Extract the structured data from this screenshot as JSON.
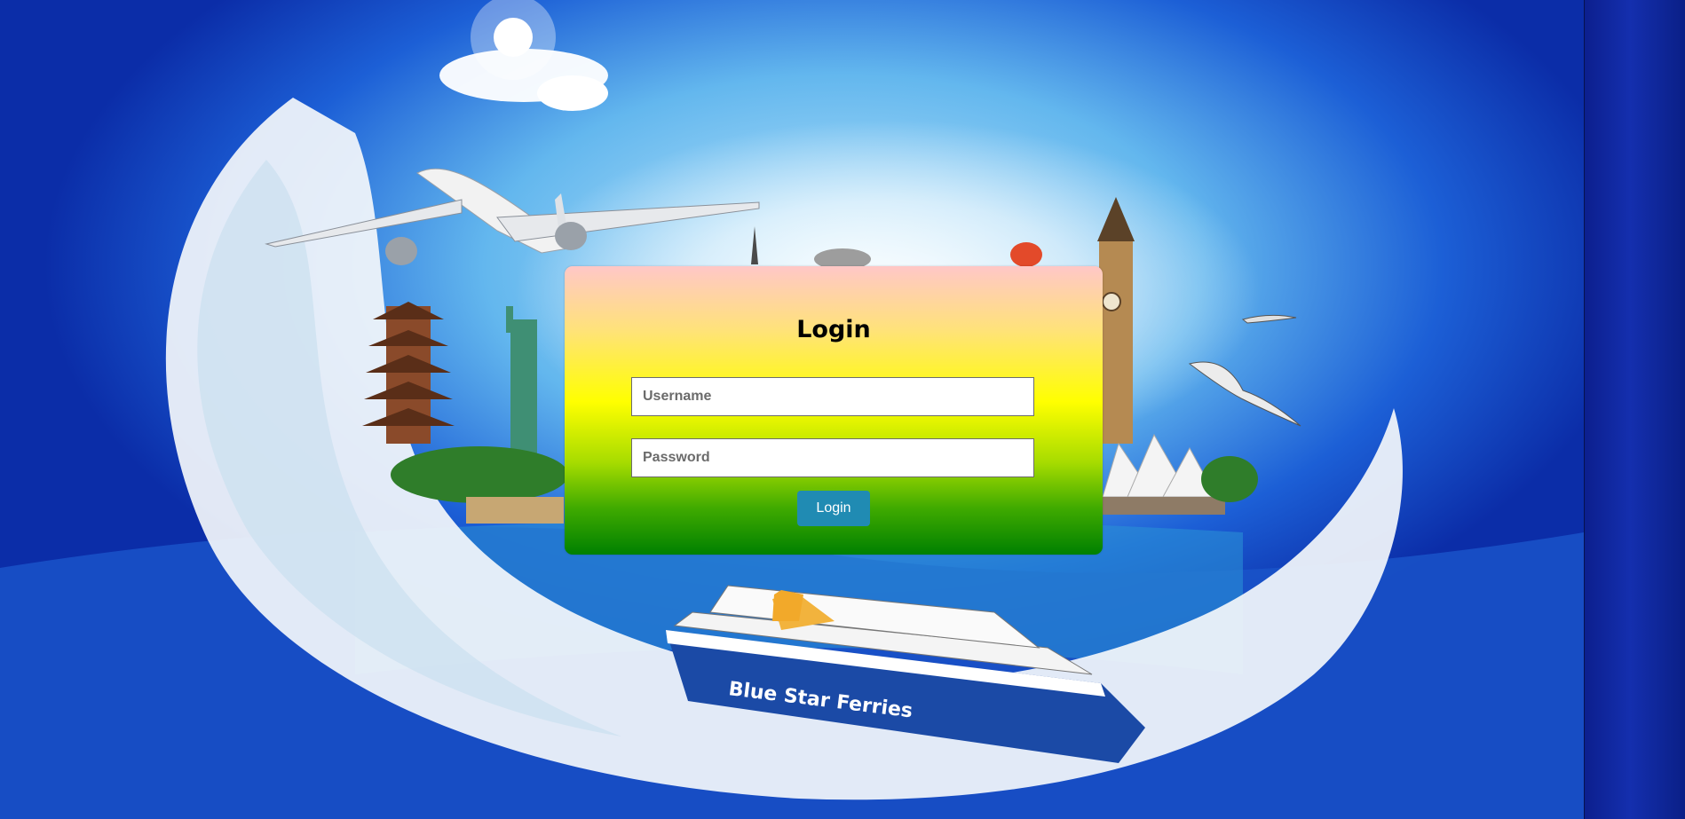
{
  "login": {
    "title": "Login",
    "username_placeholder": "Username",
    "password_placeholder": "Password",
    "submit_label": "Login"
  },
  "background": {
    "ship_name": "Blue Star Ferries"
  },
  "colors": {
    "card_gradient_top": "#ffc7c7",
    "card_gradient_mid": "#ffff00",
    "card_gradient_bottom": "#008000",
    "button": "#208bb3",
    "ocean": "#0b2da8"
  }
}
